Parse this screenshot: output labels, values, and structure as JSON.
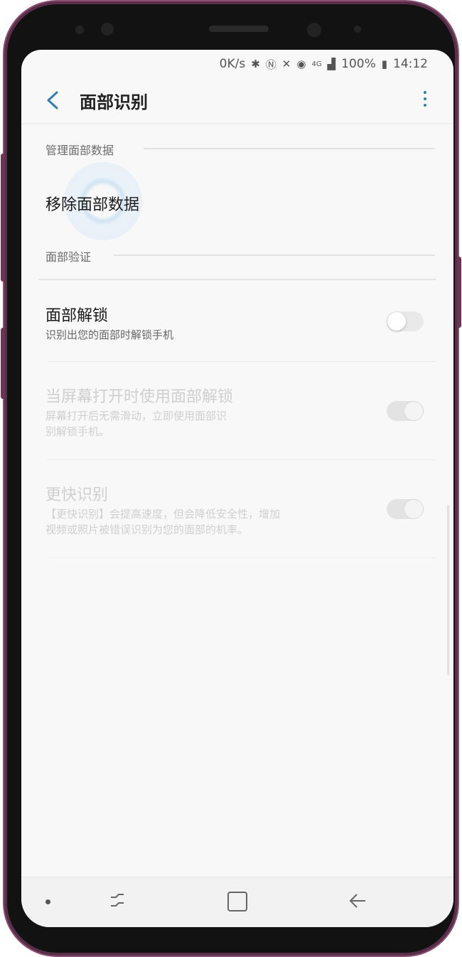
{
  "status_bar": {
    "speed": "0K/s",
    "icons": [
      "bluetooth-icon",
      "nfc-icon",
      "mute-icon",
      "alarm-icon",
      "lte-icon",
      "signal-icon",
      "battery-icon"
    ],
    "battery": "100%",
    "time": "14:12"
  },
  "app_bar": {
    "title": "面部识别",
    "accent_color": "#2f7fb5"
  },
  "sections": {
    "manage": {
      "header": "管理面部数据",
      "remove_label": "移除面部数据"
    },
    "verify": {
      "header": "面部验证",
      "face_unlock": {
        "title": "面部解锁",
        "subtitle": "识别出您的面部时解锁手机",
        "enabled": false
      },
      "screen_on_unlock": {
        "title": "当屏幕打开时使用面部解锁",
        "subtitle_line1": "屏幕打开后无需滑动，立即使用面部识",
        "subtitle_line2": "别解锁手机。",
        "enabled": true,
        "available": false
      },
      "faster_recognition": {
        "title": "更快识别",
        "subtitle_line1": "【更快识别】会提高速度，但会降低安全性，增加",
        "subtitle_line2": "视频或照片被错误识别为您的面部的机率。",
        "enabled": true,
        "available": false
      }
    }
  },
  "nav_bar": {
    "icons": [
      "dot-icon",
      "recent-apps-icon",
      "home-icon",
      "back-icon"
    ]
  }
}
